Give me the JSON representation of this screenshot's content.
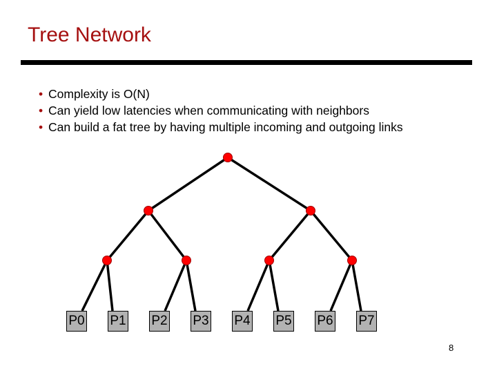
{
  "slide": {
    "title": "Tree Network",
    "bullets": [
      "Complexity is O(N)",
      "Can yield low latencies when communicating with neighbors",
      "Can build a fat tree by having multiple incoming and outgoing links"
    ],
    "bullet_glyph": "•",
    "page_number": "8"
  },
  "diagram": {
    "type": "binary-tree",
    "levels": 3,
    "node_color": "#ff0000",
    "edge_color": "#000000",
    "leaf_color": "#b2b2b2",
    "leaves": [
      "P0",
      "P1",
      "P2",
      "P3",
      "P4",
      "P5",
      "P6",
      "P7"
    ]
  },
  "colors": {
    "title": "#a50f0f",
    "rule": "#000000"
  }
}
